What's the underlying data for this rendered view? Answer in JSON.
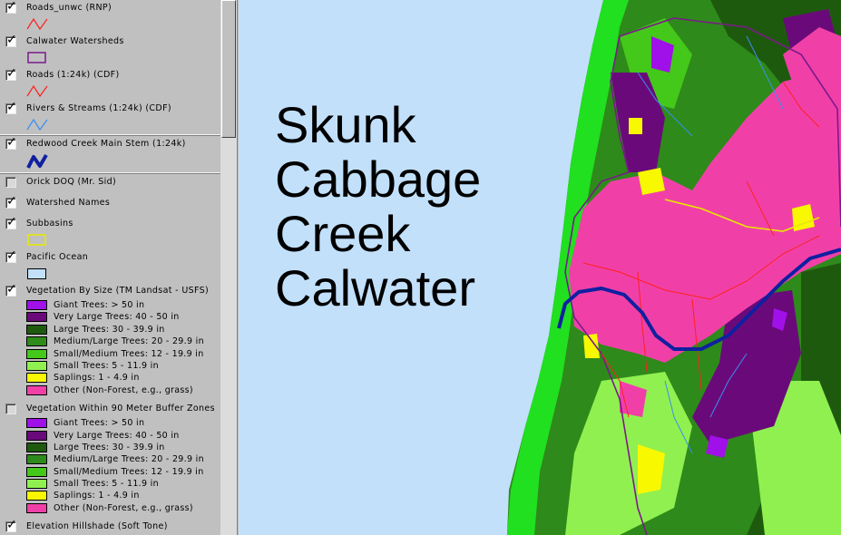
{
  "toc": {
    "layers": [
      {
        "name": "Roads_unwc (RNP)",
        "checked": true,
        "symbol": "line",
        "color": "#ff2020"
      },
      {
        "name": "Calwater Watersheds",
        "checked": true,
        "symbol": "box",
        "color": "#7b1a8a"
      },
      {
        "name": "Roads (1:24k) (CDF)",
        "checked": true,
        "symbol": "line",
        "color": "#ff2020"
      },
      {
        "name": "Rivers & Streams (1:24k) (CDF)",
        "checked": true,
        "symbol": "line",
        "color": "#3a8ef0"
      },
      {
        "name": "Redwood Creek Main Stem (1:24k)",
        "checked": true,
        "symbol": "thickline",
        "color": "#1020a0"
      },
      {
        "name": "Orick DOQ (Mr. Sid)",
        "checked": false,
        "symbol": "none"
      },
      {
        "name": "Watershed Names",
        "checked": true,
        "symbol": "none"
      },
      {
        "name": "Subbasins",
        "checked": true,
        "symbol": "box",
        "color": "#e8e800"
      },
      {
        "name": "Pacific Ocean",
        "checked": true,
        "symbol": "fill",
        "color": "#c2e0fa"
      },
      {
        "name": "Vegetation By Size (TM Landsat - USFS)",
        "checked": true,
        "symbol": "classes",
        "classes": [
          {
            "label": "Giant Trees: > 50 in",
            "color": "#a010e8"
          },
          {
            "label": "Very Large Trees: 40 - 50 in",
            "color": "#6a0a7a"
          },
          {
            "label": "Large Trees: 30 - 39.9 in",
            "color": "#1e5a0e"
          },
          {
            "label": "Medium/Large Trees: 20 - 29.9 in",
            "color": "#2e8a1a"
          },
          {
            "label": "Small/Medium Trees: 12 - 19.9 in",
            "color": "#44c81a"
          },
          {
            "label": "Small Trees: 5 - 11.9 in",
            "color": "#90f050"
          },
          {
            "label": "Saplings: 1 - 4.9 in",
            "color": "#f8f800"
          },
          {
            "label": "Other (Non-Forest, e.g., grass)",
            "color": "#f040a8"
          }
        ]
      },
      {
        "name": "Vegetation Within 90 Meter Buffer Zones",
        "checked": false,
        "symbol": "classes",
        "classes": [
          {
            "label": "Giant Trees: > 50 in",
            "color": "#a010e8"
          },
          {
            "label": "Very Large Trees: 40 - 50 in",
            "color": "#6a0a7a"
          },
          {
            "label": "Large Trees: 30 - 39.9 in",
            "color": "#1e5a0e"
          },
          {
            "label": "Medium/Large Trees: 20 - 29.9 in",
            "color": "#2e8a1a"
          },
          {
            "label": "Small/Medium Trees: 12 - 19.9 in",
            "color": "#44c81a"
          },
          {
            "label": "Small Trees: 5 - 11.9 in",
            "color": "#90f050"
          },
          {
            "label": "Saplings: 1 - 4.9 in",
            "color": "#f8f800"
          },
          {
            "label": "Other (Non-Forest, e.g., grass)",
            "color": "#f040a8"
          }
        ]
      },
      {
        "name": "Elevation Hillshade (Soft Tone)",
        "checked": true,
        "symbol": "none"
      }
    ]
  },
  "map": {
    "title_lines": [
      "Skunk",
      "Cabbage",
      "Creek",
      "Calwater"
    ],
    "ocean_color": "#c2e0fa",
    "coast_color": "#20e020",
    "land_pink": "#f040a8"
  }
}
